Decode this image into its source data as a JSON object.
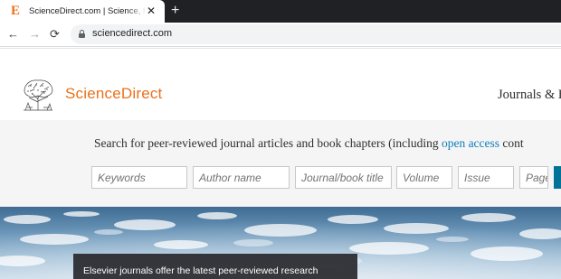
{
  "browser": {
    "tab": {
      "favicon": "E",
      "title": "ScienceDirect.com | Science, heal",
      "close_glyph": "✕"
    },
    "new_tab_glyph": "+",
    "nav": {
      "back": "←",
      "forward": "→",
      "reload": "⟳"
    },
    "address": "sciencedirect.com"
  },
  "header": {
    "brand": "ScienceDirect",
    "nav_journals": "Journals & B"
  },
  "search": {
    "intro_text": "Search for peer-reviewed journal articles and book chapters (including ",
    "intro_link": "open access",
    "intro_tail": " cont",
    "fields": {
      "keywords": "Keywords",
      "author": "Author name",
      "journal": "Journal/book title",
      "volume": "Volume",
      "issue": "Issue",
      "pages": "Pages"
    }
  },
  "hero": {
    "caption": "Elsevier journals offer the latest peer-reviewed research"
  },
  "colors": {
    "brand_orange": "#e9711c",
    "link_blue": "#0c7dbb",
    "search_button": "#007398"
  },
  "icons": [
    "elsevier-favicon",
    "close-icon",
    "plus-icon",
    "back-arrow-icon",
    "forward-arrow-icon",
    "reload-icon",
    "lock-icon",
    "elsevier-tree-logo"
  ]
}
